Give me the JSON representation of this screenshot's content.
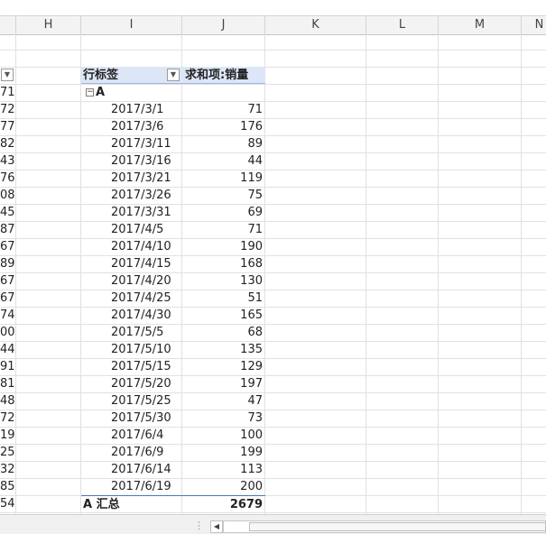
{
  "columns": [
    "H",
    "I",
    "J",
    "K",
    "L",
    "M",
    "N"
  ],
  "g_values": [
    "71",
    "72",
    "77",
    "82",
    "43",
    "76",
    "08",
    "45",
    "87",
    "67",
    "89",
    "67",
    "67",
    "74",
    "00",
    "44",
    "91",
    "81",
    "48",
    "72",
    "19",
    "25",
    "32",
    "85",
    "54"
  ],
  "pivot": {
    "header_row_label": "行标签",
    "header_value_label": "求和项:销量",
    "group_label": "A",
    "rows": [
      {
        "date": "2017/3/1",
        "value": "71"
      },
      {
        "date": "2017/3/6",
        "value": "176"
      },
      {
        "date": "2017/3/11",
        "value": "89"
      },
      {
        "date": "2017/3/16",
        "value": "44"
      },
      {
        "date": "2017/3/21",
        "value": "119"
      },
      {
        "date": "2017/3/26",
        "value": "75"
      },
      {
        "date": "2017/3/31",
        "value": "69"
      },
      {
        "date": "2017/4/5",
        "value": "71"
      },
      {
        "date": "2017/4/10",
        "value": "190"
      },
      {
        "date": "2017/4/15",
        "value": "168"
      },
      {
        "date": "2017/4/20",
        "value": "130"
      },
      {
        "date": "2017/4/25",
        "value": "51"
      },
      {
        "date": "2017/4/30",
        "value": "165"
      },
      {
        "date": "2017/5/5",
        "value": "68"
      },
      {
        "date": "2017/5/10",
        "value": "135"
      },
      {
        "date": "2017/5/15",
        "value": "129"
      },
      {
        "date": "2017/5/20",
        "value": "197"
      },
      {
        "date": "2017/5/25",
        "value": "47"
      },
      {
        "date": "2017/5/30",
        "value": "73"
      },
      {
        "date": "2017/6/4",
        "value": "100"
      },
      {
        "date": "2017/6/9",
        "value": "199"
      },
      {
        "date": "2017/6/14",
        "value": "113"
      },
      {
        "date": "2017/6/19",
        "value": "200"
      }
    ],
    "total_label": "A 汇总",
    "total_value": "2679"
  },
  "colors": {
    "pivot_header_bg": "#dce6f7",
    "pivot_rule": "#4a76c2"
  },
  "icons": {
    "filter": "dropdown-arrow",
    "collapse": "minus-box",
    "scroll": "left-arrow"
  }
}
